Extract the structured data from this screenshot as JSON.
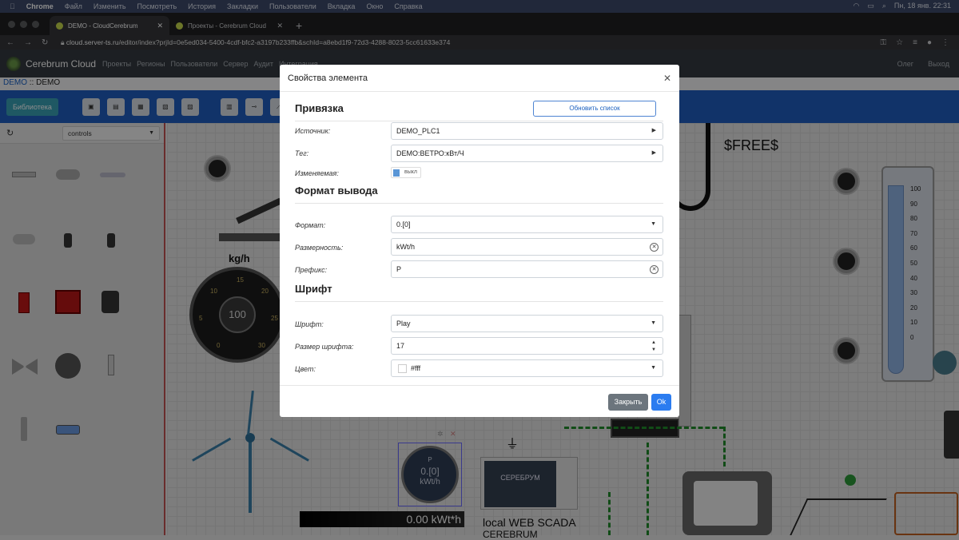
{
  "mac_menu": {
    "app": "Chrome",
    "items": [
      "Файл",
      "Изменить",
      "Посмотреть",
      "История",
      "Закладки",
      "Пользователи",
      "Вкладка",
      "Окно",
      "Справка"
    ],
    "clock": "Пн, 18 янв. 22:31"
  },
  "browser": {
    "tabs": [
      {
        "title": "DEMO - CloudCerebrum",
        "active": true
      },
      {
        "title": "Проекты - Cerebrum Cloud",
        "active": false
      }
    ],
    "url_host": "cloud.server-ts.ru",
    "url_path": "/editor/index?prjId=0e5ed034-5400-4cdf-bfc2-a3197b233ffb&schId=a8ebd1f9-72d3-4288-8023-5cc61633e374"
  },
  "app_nav": {
    "brand": "Cerebrum Cloud",
    "menu": [
      "Проекты",
      "Регионы",
      "Пользователи",
      "Сервер",
      "Аудит",
      "Интеграция"
    ],
    "user": "Олег",
    "logout": "Выход"
  },
  "breadcrumb": {
    "link": "DEMO",
    "sep": " :: ",
    "current": "DEMO"
  },
  "toolbar": {
    "library": "Библиотека"
  },
  "left_panel": {
    "category": "controls"
  },
  "canvas": {
    "gauge_label": "kg/h",
    "gauge_value": "100",
    "gauge_ticks": [
      "0",
      "5",
      "10",
      "15",
      "20",
      "25",
      "30"
    ],
    "tank_ticks": [
      "100",
      "90",
      "80",
      "70",
      "60",
      "50",
      "40",
      "30",
      "20",
      "10",
      "0"
    ],
    "free_text": "$FREE$",
    "meter_prefix": "P",
    "meter_value": "0.[0]",
    "meter_unit": "kWt/h",
    "readout": "0.00 kWt*h",
    "scada_label": "local WEB SCADA",
    "scada_label2": "CEREBRUM",
    "device_brand": "СЕРЕБРУМ"
  },
  "dialog": {
    "title": "Свойства элемента",
    "sections": {
      "binding": "Привязка",
      "output_format": "Формат вывода",
      "font": "Шрифт"
    },
    "refresh_button": "Обновить список",
    "fields": {
      "source": {
        "label": "Источник:",
        "value": "DEMO_PLC1"
      },
      "tag": {
        "label": "Тег:",
        "value": "DEMO:ВЕТРО:кВт/Ч"
      },
      "editable": {
        "label": "Изменяемая:",
        "value": "выкл"
      },
      "format": {
        "label": "Формат:",
        "value": "0.[0]"
      },
      "dimension": {
        "label": "Размерность:",
        "value": "kWt/h"
      },
      "prefix": {
        "label": "Префикс:",
        "value": "P"
      },
      "font": {
        "label": "Шрифт:",
        "value": "Play"
      },
      "font_size": {
        "label": "Размер шрифта:",
        "value": "17"
      },
      "color": {
        "label": "Цвет:",
        "value": "#fff"
      }
    },
    "close_button": "Закрыть",
    "ok_button": "Ok"
  },
  "colors": {
    "toolbar": "#1f5ebf",
    "primary_button": "#2b7cf0",
    "nav": "#343a40"
  }
}
